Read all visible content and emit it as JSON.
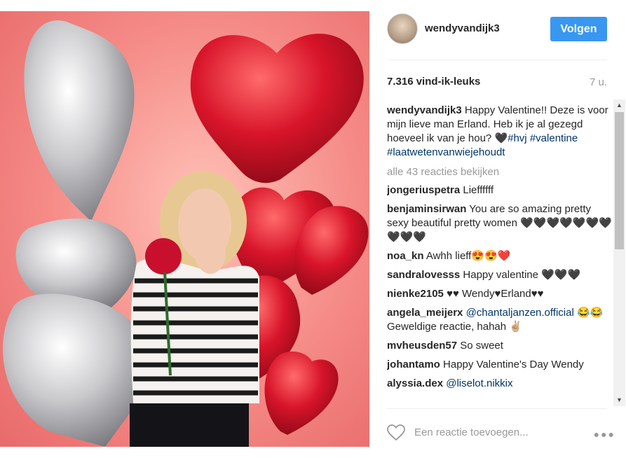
{
  "post": {
    "username": "wendyvandijk3",
    "follow_label": "Volgen",
    "likes": "7.316 vind-ik-leuks",
    "age": "7 u.",
    "caption_user": "wendyvandijk3",
    "caption_text": "Happy Valentine!! Deze is voor mijn lieve man Erland. Heb ik je al gezegd hoeveel ik van je hou? 🖤",
    "caption_tags": [
      "#hvj",
      "#valentine",
      "#laatwetenvanwiejehoudt"
    ],
    "view_all": "alle 43 reacties bekijken",
    "add_comment_placeholder": "Een reactie toevoegen...",
    "more_icon": "ellipsis-icon",
    "heart_icon": "heart-outline-icon"
  },
  "comments": [
    {
      "user": "jongeriuspetra",
      "text": "Lieffffff"
    },
    {
      "user": "benjaminsirwan",
      "text": "You are so amazing pretty sexy beautiful pretty women 🖤🖤🖤🖤🖤🖤🖤🖤🖤🖤"
    },
    {
      "user": "noa_kn",
      "text": "Awhh lieff😍😍❤️"
    },
    {
      "user": "sandralovesss",
      "text": "Happy valentine 🖤🖤🖤"
    },
    {
      "user": "nienke2105",
      "text": "♥♥ Wendy♥Erland♥♥"
    },
    {
      "user": "angela_meijerx",
      "mention": "@chantaljanzen.official",
      "text": "😂😂 Geweldige reactie, hahah ✌🏼"
    },
    {
      "user": "mvheusden57",
      "text": "So sweet"
    },
    {
      "user": "johantamo",
      "text": "Happy Valentine's Day Wendy"
    },
    {
      "user": "alyssia.dex",
      "mention": "@liselot.nikkix",
      "text": ""
    }
  ],
  "colors": {
    "follow": "#3897f0",
    "link": "#003569",
    "balloon": "#d8142a"
  }
}
